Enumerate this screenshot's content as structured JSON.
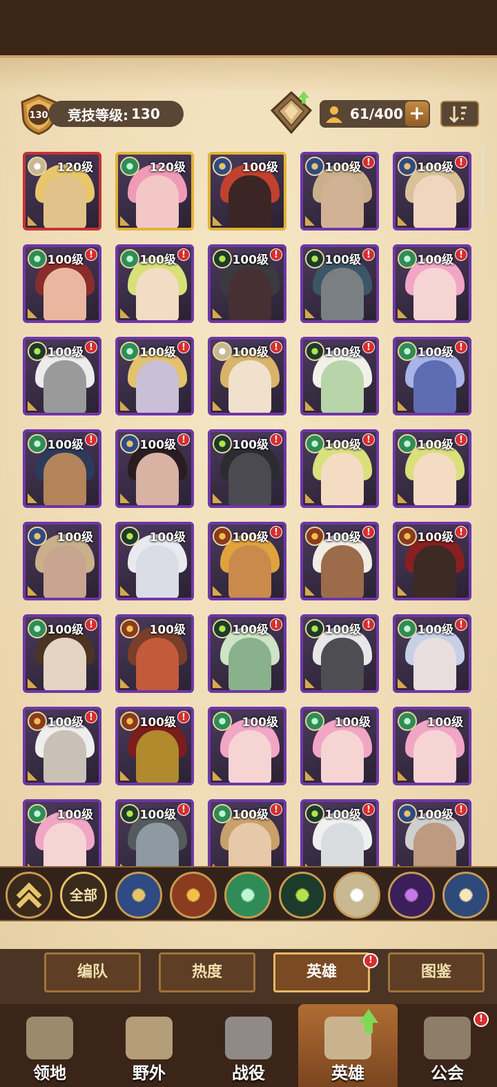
{
  "header": {
    "rank_badge_value": "130",
    "rank_label": "竞技等级:",
    "rank_value": "130",
    "capacity": "61/400",
    "capacity_add_symbol": "+"
  },
  "heroes": [
    {
      "level": "120级",
      "faction": "celestial",
      "frame": "red",
      "alert": false,
      "face": "#e2c28b",
      "hair": "#e8c66b"
    },
    {
      "level": "120级",
      "faction": "wilder",
      "frame": "gold",
      "alert": false,
      "face": "#f2c7c6",
      "hair": "#f09bb5"
    },
    {
      "level": "100级",
      "faction": "lightbearer",
      "frame": "gold",
      "alert": false,
      "face": "#3b2525",
      "hair": "#c0412e"
    },
    {
      "level": "100级",
      "faction": "lightbearer",
      "frame": "purple",
      "alert": true,
      "face": "#d1b295",
      "hair": "#c9b08a"
    },
    {
      "level": "100级",
      "faction": "lightbearer",
      "frame": "purple",
      "alert": true,
      "face": "#f1d6bf",
      "hair": "#d9c29a"
    },
    {
      "level": "100级",
      "faction": "wilder",
      "frame": "purple",
      "alert": true,
      "face": "#e9b7a0",
      "hair": "#8b2c2c"
    },
    {
      "level": "100级",
      "faction": "wilder",
      "frame": "purple",
      "alert": true,
      "face": "#f2dcc3",
      "hair": "#d8e07a"
    },
    {
      "level": "100级",
      "faction": "graveborn",
      "frame": "purple",
      "alert": true,
      "face": "#473033",
      "hair": "#3b3a40"
    },
    {
      "level": "100级",
      "faction": "graveborn",
      "frame": "purple",
      "alert": true,
      "face": "#7a7f83",
      "hair": "#3c5567"
    },
    {
      "level": "100级",
      "faction": "wilder",
      "frame": "purple",
      "alert": true,
      "face": "#f7d4d4",
      "hair": "#f1a6c6"
    },
    {
      "level": "100级",
      "faction": "graveborn",
      "frame": "purple",
      "alert": true,
      "face": "#9a9a9a",
      "hair": "#ececec"
    },
    {
      "level": "100级",
      "faction": "wilder",
      "frame": "purple",
      "alert": true,
      "face": "#c9c0d8",
      "hair": "#e3c26d"
    },
    {
      "level": "100级",
      "faction": "celestial",
      "frame": "purple",
      "alert": true,
      "face": "#efe1cb",
      "hair": "#d8b46a"
    },
    {
      "level": "100级",
      "faction": "graveborn",
      "frame": "purple",
      "alert": true,
      "face": "#b8d4a9",
      "hair": "#f1f1ea"
    },
    {
      "level": "100级",
      "faction": "wilder",
      "frame": "purple",
      "alert": true,
      "face": "#5e6cb3",
      "hair": "#aab4e8"
    },
    {
      "level": "100级",
      "faction": "wilder",
      "frame": "purple",
      "alert": true,
      "face": "#b4845a",
      "hair": "#2d3a5a"
    },
    {
      "level": "100级",
      "faction": "lightbearer",
      "frame": "purple",
      "alert": true,
      "face": "#d8b3a4",
      "hair": "#2a1d22"
    },
    {
      "level": "100级",
      "faction": "graveborn",
      "frame": "purple",
      "alert": true,
      "face": "#4a4a50",
      "hair": "#2c2c30"
    },
    {
      "level": "100级",
      "faction": "wilder",
      "frame": "purple",
      "alert": true,
      "face": "#f3dcc1",
      "hair": "#d9e07c"
    },
    {
      "level": "100级",
      "faction": "wilder",
      "frame": "purple",
      "alert": true,
      "face": "#f3dcc1",
      "hair": "#d9e07c"
    },
    {
      "level": "100级",
      "faction": "lightbearer",
      "frame": "purple",
      "alert": false,
      "face": "#c8a590",
      "hair": "#c9b08a"
    },
    {
      "level": "100级",
      "faction": "graveborn",
      "frame": "purple",
      "alert": false,
      "face": "#dadde6",
      "hair": "#e8eaf0"
    },
    {
      "level": "100级",
      "faction": "mauler",
      "frame": "purple",
      "alert": true,
      "face": "#c98a4c",
      "hair": "#e0a23c"
    },
    {
      "level": "100级",
      "faction": "mauler",
      "frame": "purple",
      "alert": true,
      "face": "#9b6b4a",
      "hair": "#f0ede4"
    },
    {
      "level": "100级",
      "faction": "mauler",
      "frame": "purple",
      "alert": true,
      "face": "#3c2a25",
      "hair": "#8a1f1f"
    },
    {
      "level": "100级",
      "faction": "wilder",
      "frame": "purple",
      "alert": true,
      "face": "#e3d4c4",
      "hair": "#4b3424"
    },
    {
      "level": "100级",
      "faction": "mauler",
      "frame": "purple",
      "alert": false,
      "face": "#c35a3a",
      "hair": "#7a3e2a"
    },
    {
      "level": "100级",
      "faction": "graveborn",
      "frame": "purple",
      "alert": true,
      "face": "#89b18b",
      "hair": "#cfe3c6"
    },
    {
      "level": "100级",
      "faction": "graveborn",
      "frame": "purple",
      "alert": true,
      "face": "#4d4d52",
      "hair": "#e7e7e7"
    },
    {
      "level": "100级",
      "faction": "wilder",
      "frame": "purple",
      "alert": true,
      "face": "#e7dedd",
      "hair": "#c8d0e8"
    },
    {
      "level": "100级",
      "faction": "mauler",
      "frame": "purple",
      "alert": true,
      "face": "#c9c1b5",
      "hair": "#eeeeee"
    },
    {
      "level": "100级",
      "faction": "mauler",
      "frame": "purple",
      "alert": true,
      "face": "#b08a2c",
      "hair": "#7a1d1d"
    },
    {
      "level": "100级",
      "faction": "wilder",
      "frame": "purple",
      "alert": false,
      "face": "#f7d4d4",
      "hair": "#f1a6c6"
    },
    {
      "level": "100级",
      "faction": "wilder",
      "frame": "purple",
      "alert": false,
      "face": "#f7d4d4",
      "hair": "#f1a6c6"
    },
    {
      "level": "100级",
      "faction": "wilder",
      "frame": "purple",
      "alert": false,
      "face": "#f7d4d4",
      "hair": "#f1a6c6"
    },
    {
      "level": "100级",
      "faction": "wilder",
      "frame": "purple",
      "alert": false,
      "face": "#f7d4d4",
      "hair": "#f1a6c6"
    },
    {
      "level": "100级",
      "faction": "graveborn",
      "frame": "purple",
      "alert": true,
      "face": "#8d9aa1",
      "hair": "#565a5e"
    },
    {
      "level": "100级",
      "faction": "wilder",
      "frame": "purple",
      "alert": true,
      "face": "#e7c8a8",
      "hair": "#c7a06a"
    },
    {
      "level": "100级",
      "faction": "graveborn",
      "frame": "purple",
      "alert": true,
      "face": "#d9dddf",
      "hair": "#f0f0f0"
    },
    {
      "level": "100级",
      "faction": "lightbearer",
      "frame": "purple",
      "alert": true,
      "face": "#bd9a80",
      "hair": "#cfcfcf"
    }
  ],
  "filter_bar": {
    "collapse_icon": "double-chevron-up-icon",
    "all_label": "全部",
    "factions": [
      {
        "name": "lightbearer",
        "color": "#e7c46a",
        "bg": "#2f4a84"
      },
      {
        "name": "mauler",
        "color": "#f0c04a",
        "bg": "#8b3b1e"
      },
      {
        "name": "wilder",
        "color": "#bff5d3",
        "bg": "#2f8c57"
      },
      {
        "name": "graveborn",
        "color": "#b6e24b",
        "bg": "#1c3b2a"
      },
      {
        "name": "celestial",
        "color": "#ffffff",
        "bg": "#c9b993"
      },
      {
        "name": "hypogean",
        "color": "#c27ae8",
        "bg": "#3a1f5a"
      },
      {
        "name": "dimensional",
        "color": "#f6e7b6",
        "bg": "#2e4a7a"
      }
    ]
  },
  "tabs": [
    {
      "label": "编队",
      "active": false
    },
    {
      "label": "热度",
      "active": false
    },
    {
      "label": "英雄",
      "active": true
    },
    {
      "label": "图鉴",
      "active": false
    }
  ],
  "tab_alert": "!",
  "nav": [
    {
      "label": "领地",
      "icon": "castle-icon",
      "active": false
    },
    {
      "label": "野外",
      "icon": "scroll-map-icon",
      "active": false
    },
    {
      "label": "战役",
      "icon": "swords-icon",
      "active": false
    },
    {
      "label": "英雄",
      "icon": "hero-helmet-icon",
      "active": true
    },
    {
      "label": "公会",
      "icon": "guild-shield-icon",
      "active": false
    }
  ],
  "nav_alert": "!",
  "colors": {
    "frame_purple": "#6f36a8",
    "frame_red": "#c53232",
    "frame_gold": "#e0b437",
    "alert_red": "#d62e2e",
    "panel_bg": "#f2e2bf"
  }
}
